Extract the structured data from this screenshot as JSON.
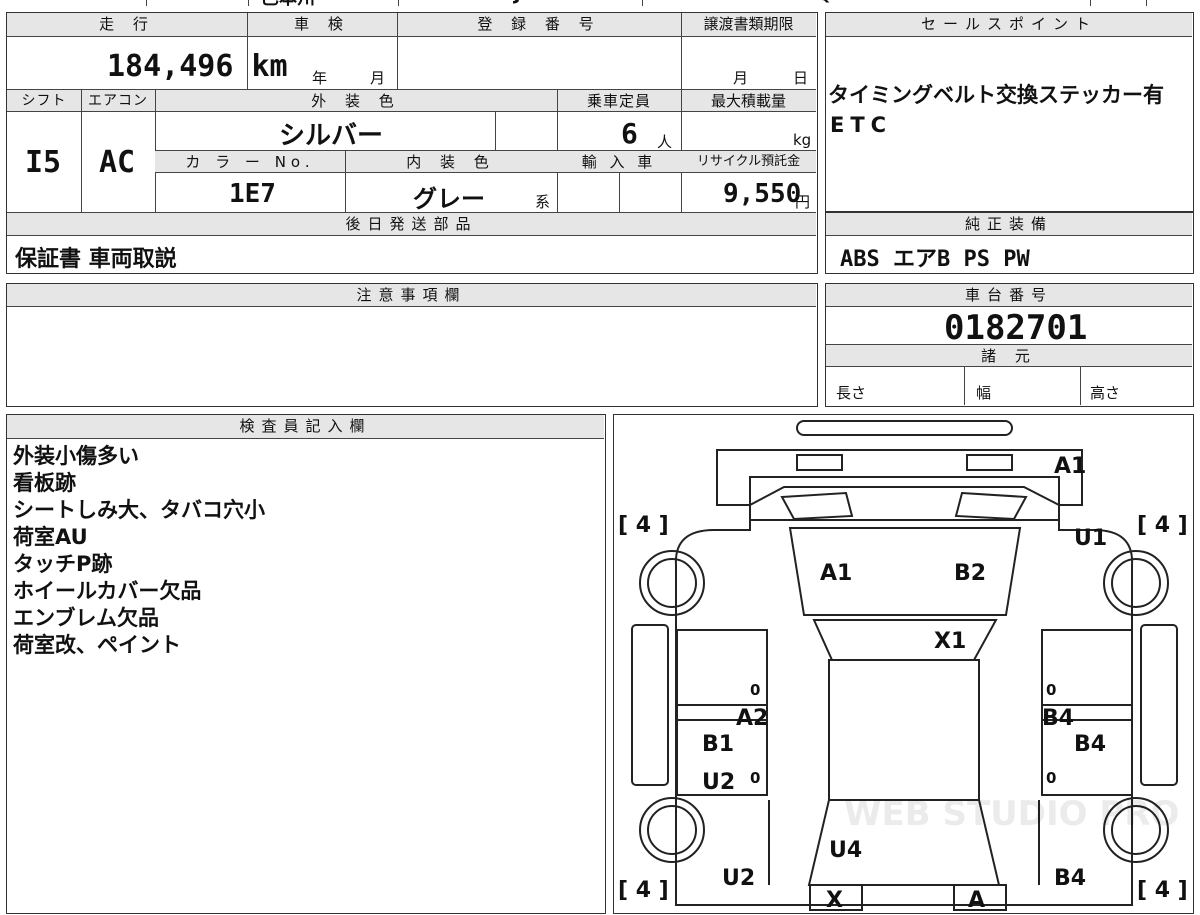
{
  "top_strip": {
    "frag1": "巴本州",
    "frag2": "J",
    "frag3": "Q"
  },
  "vehicle": {
    "mileage_label": "走 行",
    "mileage_value": "184,496",
    "mileage_unit": "km",
    "shaken_label": "車 検",
    "shaken_year": "年",
    "shaken_month": "月",
    "reg_label": "登 録 番 号",
    "reg_value": "",
    "deadline_label": "譲渡書類期限",
    "deadline_month": "月",
    "deadline_day": "日",
    "shift_label": "シフト",
    "shift_value": "I5",
    "ac_label": "エアコン",
    "ac_value": "AC",
    "exterior_label": "外 装 色",
    "exterior_value": "シルバー",
    "capacity_label": "乗車定員",
    "capacity_value": "6",
    "capacity_unit": "人",
    "load_label": "最大積載量",
    "load_unit": "kg",
    "color_no_label": "カ ラ ー No.",
    "color_no_value": "1E7",
    "interior_label": "内 装 色",
    "interior_value": "グレー",
    "interior_suffix": "系",
    "import_label": "輸 入 車",
    "recycle_label": "リサイクル預託金",
    "recycle_value": "9,550",
    "recycle_unit": "円"
  },
  "sales_points": {
    "label": "セールスポイント",
    "lines": [
      "タイミングベルト交換ステッカー有",
      "ETC"
    ]
  },
  "later_parts": {
    "label": "後日発送部品",
    "value": "保証書 車両取説"
  },
  "genuine_equipment": {
    "label": "純正装備",
    "value": "ABS エアB PS PW"
  },
  "notice": {
    "label": "注意事項欄",
    "value": ""
  },
  "chassis": {
    "label": "車台番号",
    "value": "0182701"
  },
  "specs": {
    "label": "諸 元",
    "length": "長さ",
    "width": "幅",
    "height": "高さ"
  },
  "inspector": {
    "label": "検査員記入欄",
    "notes": [
      "外装小傷多い",
      "看板跡",
      "シートしみ大、タバコ穴小",
      "荷室AU",
      "タッチP跡",
      "ホイールカバー欠品",
      "エンブレム欠品",
      "荷室改、ペイント"
    ]
  },
  "diagram": {
    "tire_marks": [
      "[ 4 ]",
      "[ 4 ]",
      "[ 4 ]",
      "[ 4 ]"
    ],
    "damage_codes": [
      "A1",
      "U1",
      "A1",
      "B2",
      "X1",
      "A2",
      "B4",
      "B1",
      "B4",
      "U2",
      "U4",
      "U2",
      "B4",
      "X",
      "A"
    ],
    "zero_marks": [
      "0",
      "0",
      "0",
      "0"
    ],
    "watermark": "WEB STUDIO PRO"
  }
}
